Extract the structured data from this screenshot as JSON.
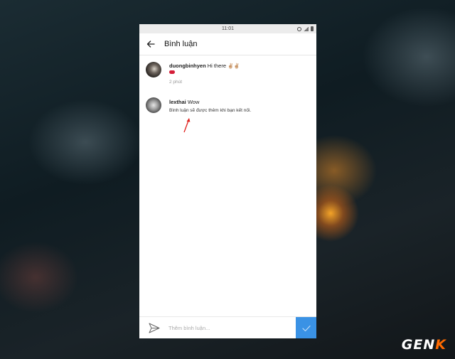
{
  "status_bar": {
    "time": "11:01"
  },
  "header": {
    "title": "Bình luận"
  },
  "comments": [
    {
      "username": "duongbinhyen",
      "text": "Hi there",
      "emoji": "✌🏼✌🏼",
      "time_ago": "2 phút"
    },
    {
      "username": "lexthai",
      "text": "Wow",
      "note": "Bình luận sẽ được thêm khi bạn kết nối."
    }
  ],
  "composer": {
    "placeholder": "Thêm bình luận..."
  },
  "watermark": {
    "text": "GEN",
    "accent_text": "K"
  },
  "colors": {
    "post_button": "#3a92e5",
    "annotation_arrow": "#e0201c"
  },
  "icons": [
    "back-arrow-icon",
    "send-direct-icon",
    "checkmark-icon",
    "alarm-icon",
    "signal-icon",
    "battery-icon"
  ]
}
